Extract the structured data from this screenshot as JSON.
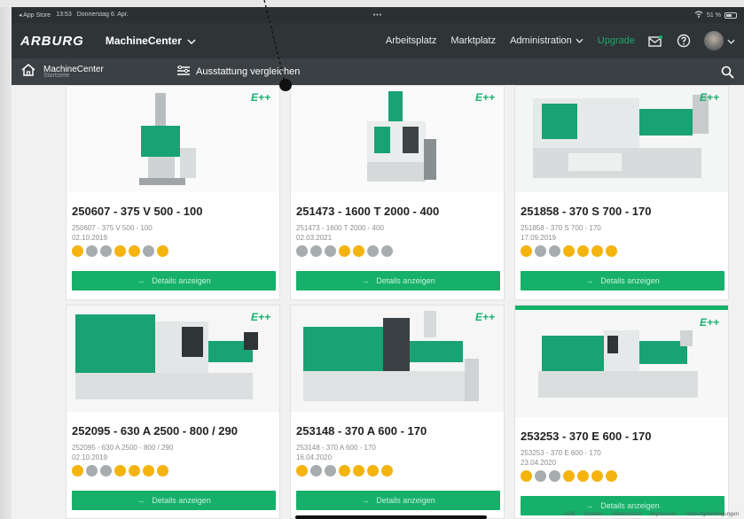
{
  "statusbar": {
    "app_store": "◂ App Store",
    "time": "13:53",
    "date": "Donnerstag 6. Apr.",
    "dots": "•••",
    "battery": "51 %"
  },
  "topnav": {
    "logo": "ARBURG",
    "title": "MachineCenter",
    "links": [
      "Arbeitsplatz",
      "Marktplatz",
      "Administration",
      "Upgrade"
    ]
  },
  "subnav": {
    "home_title": "MachineCenter",
    "home_sub": "Startseite",
    "compare": "Ausstattung vergleichen"
  },
  "cards": [
    {
      "title": "250607 - 375 V 500 - 100",
      "sub": "250607 - 375 V 500 - 100",
      "date": "02.10.2019",
      "badge": "E++",
      "button": "Details anzeigen",
      "dots": [
        "y",
        "g",
        "g",
        "y",
        "y",
        "g",
        "y"
      ]
    },
    {
      "title": "251473 - 1600 T 2000 - 400",
      "sub": "251473 - 1600 T 2000 - 400",
      "date": "02.03.2021",
      "badge": "E++",
      "button": "Details anzeigen",
      "dots": [
        "g",
        "g",
        "g",
        "y",
        "y",
        "g",
        "g"
      ]
    },
    {
      "title": "251858 - 370 S 700 - 170",
      "sub": "251858 - 370 S 700 - 170",
      "date": "17.09.2019",
      "badge": "E++",
      "button": "Details anzeigen",
      "dots": [
        "y",
        "g",
        "g",
        "y",
        "y",
        "y",
        "y"
      ]
    },
    {
      "title": "252095 - 630 A 2500 - 800 / 290",
      "sub": "252095 - 630 A 2500 - 800 / 290",
      "date": "02.10.2019",
      "badge": "E++",
      "button": "Details anzeigen",
      "dots": [
        "y",
        "g",
        "g",
        "y",
        "y",
        "y",
        "y"
      ]
    },
    {
      "title": "253148 - 370 A 600 - 170",
      "sub": "253148 - 370 A 600 - 170",
      "date": "16.04.2020",
      "badge": "E++",
      "button": "Details anzeigen",
      "dots": [
        "y",
        "g",
        "g",
        "y",
        "y",
        "y",
        "y"
      ]
    },
    {
      "title": "253253 - 370 E 600 - 170",
      "sub": "253253 - 370 E 600 - 170",
      "date": "23.04.2020",
      "badge": "E++",
      "button": "Details anzeigen",
      "dots": [
        "y",
        "g",
        "g",
        "y",
        "y",
        "y",
        "y"
      ]
    }
  ],
  "footer": [
    "AGB",
    "Cookies",
    "Datenschutz",
    "Impressum",
    "Nutzungsbedingungen"
  ],
  "colors": {
    "accent": "#16b06a",
    "nav": "#2f3537",
    "subnav": "#3a4043",
    "badge_yellow": "#f4b30e"
  }
}
